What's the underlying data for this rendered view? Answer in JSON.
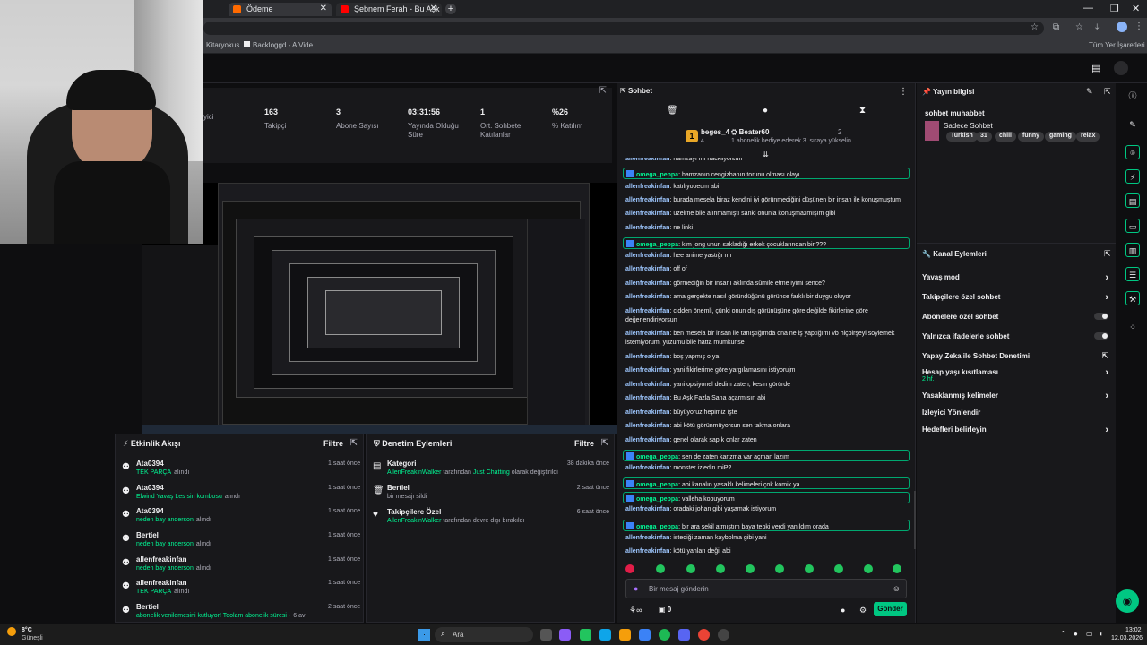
{
  "browser": {
    "tabs": [
      {
        "label": "Ödeme",
        "favicon": "#ff6a00"
      },
      {
        "label": "Şebnem Ferah - Bu Aşk Fazl",
        "favicon": "#ff0000"
      }
    ],
    "bookmarks": [
      "Kitaryokus...",
      "Backloggd - A Vide..."
    ],
    "all_bookmarks": "Tüm Yer İşaretleri"
  },
  "stats": [
    {
      "value": "",
      "label": "yici"
    },
    {
      "value": "163",
      "label": "Takipçi"
    },
    {
      "value": "3",
      "label": "Abone Sayısı"
    },
    {
      "value": "03:31:56",
      "label": "Yayında Olduğu Süre"
    },
    {
      "value": "1",
      "label": "Ort. Sohbete Katılanlar"
    },
    {
      "value": "%26",
      "label": "% Katılım"
    }
  ],
  "activity": {
    "title": "Etkinlik Akışı",
    "filter": "Filtre",
    "items": [
      {
        "name": "Ata0394",
        "sub": "TEK PARÇA",
        "sub2": "alındı",
        "time": "1 saat önce"
      },
      {
        "name": "Ata0394",
        "sub": "Elwind Yavaş Les sin kombosu",
        "sub2": "alındı",
        "time": "1 saat önce"
      },
      {
        "name": "Ata0394",
        "sub": "neden bay anderson",
        "sub2": "alındı",
        "time": "1 saat önce"
      },
      {
        "name": "Bertiel",
        "sub": "neden bay anderson",
        "sub2": "alındı",
        "time": "1 saat önce"
      },
      {
        "name": "allenfreakinfan",
        "sub": "neden bay anderson",
        "sub2": "alındı",
        "time": "1 saat önce"
      },
      {
        "name": "allenfreakinfan",
        "sub": "TEK PARÇA",
        "sub2": "alındı",
        "time": "1 saat önce"
      },
      {
        "name": "Bertiel",
        "sub": "abonelik venilemesini kutluyor! Toolam abonelik süresi -",
        "sub2": "6 av!",
        "time": "2 saat önce"
      }
    ]
  },
  "moderation": {
    "title": "Denetim Eylemleri",
    "filter": "Filtre",
    "items": [
      {
        "name": "Kategori",
        "actor": "AllenFreakinWalker",
        "mid": "tarafından",
        "hl": "Just Chatting",
        "rest": "olarak değiştirildi",
        "time": "38 dakika önce",
        "icon": "▤"
      },
      {
        "name": "Bertiel",
        "actor": "",
        "mid": "bir mesajı sildi",
        "hl": "",
        "rest": "",
        "time": "2 saat önce",
        "icon": "🗑"
      },
      {
        "name": "Takipçilere Özel",
        "actor": "AllenFreakinWalker",
        "mid": "tarafından devre dışı bırakıldı",
        "hl": "",
        "rest": "",
        "time": "6 saat önce",
        "icon": "♥"
      }
    ]
  },
  "chat": {
    "title": "Sohbet",
    "leader": {
      "user": "beges_4",
      "count": "4",
      "gifter": "Beater60",
      "gifter_count": "2",
      "note": "1 abonelik hediye ederek 3. sıraya yükselin"
    },
    "messages": [
      {
        "user": "allenfreakinfan",
        "text": "hamzayı mı hackliyorsun",
        "hl": false
      },
      {
        "user": "omega_peppa",
        "text": "hamzanın cengizhanın torunu olması olayı",
        "hl": true
      },
      {
        "user": "allenfreakinfan",
        "text": "katılıyooeum abi",
        "hl": false
      },
      {
        "user": "allenfreakinfan",
        "text": "burada mesela biraz kendini iyi görünmediğini düşünen bir insan ile konuşmuştum",
        "hl": false
      },
      {
        "user": "allenfreakinfan",
        "text": "üzelrne bile alınmamıştı sanki onunla konuşmazmışım gibi",
        "hl": false
      },
      {
        "user": "allenfreakinfan",
        "text": "ne linki",
        "hl": false
      },
      {
        "user": "omega_peppa",
        "text": "kim jong unun sakladığı erkek çocuklarından biri???",
        "hl": true
      },
      {
        "user": "allenfreakinfan",
        "text": "hee anime yastığı mı",
        "hl": false
      },
      {
        "user": "allenfreakinfan",
        "text": "off of",
        "hl": false
      },
      {
        "user": "allenfreakinfan",
        "text": "görmediğin bir insanı aklında sümile etme iyimi sence?",
        "hl": false
      },
      {
        "user": "allenfreakinfan",
        "text": "ama gerçekte nasıl göründüğünü görünce farklı bir duygu oluyor",
        "hl": false
      },
      {
        "user": "allenfreakinfan",
        "text": "cidden önemli, çünki onun dış görünüşüne göre değilde fikirlerine göre değerlendiriyorsun",
        "hl": false
      },
      {
        "user": "allenfreakinfan",
        "text": "ben mesela bir insan ile tanıştığımda ona ne iş yaptığımı vb hiçbirşeyi söylemek istemiyorum, yüzümü bile hatta mümkünse",
        "hl": false
      },
      {
        "user": "allenfreakinfan",
        "text": "boş yapmış o ya",
        "hl": false
      },
      {
        "user": "allenfreakinfan",
        "text": "yani fikirlerime göre yargılamasını istiyorujm",
        "hl": false
      },
      {
        "user": "allenfreakinfan",
        "text": "yani opsiyonel dedim zaten, kesin görürde",
        "hl": false
      },
      {
        "user": "allenfreakinfan",
        "text": "Bu Aşk Fazla Sana açarmısın abi",
        "hl": false
      },
      {
        "user": "allenfreakinfan",
        "text": "büyüyoruz hepimiz işte",
        "hl": false
      },
      {
        "user": "allenfreakinfan",
        "text": "abi kötü görünmüyorsun sen takma onlara",
        "hl": false
      },
      {
        "user": "allenfreakinfan",
        "text": "genel olarak sapık onlar zaten",
        "hl": false
      },
      {
        "user": "omega_peppa",
        "text": "sen de zaten karizma var açman lazım",
        "hl": true
      },
      {
        "user": "allenfreakinfan",
        "text": "monster izledin miP?",
        "hl": false
      },
      {
        "user": "omega_peppa",
        "text": "abi kanalın yasaklı kelimeleri çok komik ya",
        "hl": true
      },
      {
        "user": "omega_peppa",
        "text": "valleha kopuyorum",
        "hl": true
      },
      {
        "user": "allenfreakinfan",
        "text": "oradaki johan gibi yaşamak istiyorum",
        "hl": false
      },
      {
        "user": "omega_peppa",
        "text": "bir ara şekil atmıştım baya tepki verdi yanıldım orada",
        "hl": true
      },
      {
        "user": "allenfreakinfan",
        "text": "istediği zaman kaybolma gibi yani",
        "hl": false
      },
      {
        "user": "allenfreakinfan",
        "text": "kötü yanları değil abi",
        "hl": false
      }
    ],
    "input_placeholder": "Bir mesaj gönderin",
    "points": "0",
    "send": "Gönder"
  },
  "stream_info": {
    "title": "Yayın bilgisi",
    "stream_title": "sohbet muhabbet",
    "category": "Sadece Sohbet",
    "tags": [
      "Turkish",
      "31",
      "chill",
      "funny",
      "gaming",
      "relax"
    ]
  },
  "channel_actions": {
    "title": "Kanal Eylemleri",
    "items": [
      {
        "label": "Yavaş mod",
        "type": "chevron"
      },
      {
        "label": "Takipçilere özel sohbet",
        "type": "chevron"
      },
      {
        "label": "Abonelere özel sohbet",
        "type": "toggle"
      },
      {
        "label": "Yalnızca ifadelerle sohbet",
        "type": "toggle"
      },
      {
        "label": "Yapay Zeka ile Sohbet Denetimi",
        "type": "external"
      },
      {
        "label": "Hesap yaşı kısıtlaması",
        "sub": "2 hf.",
        "type": "chevron"
      },
      {
        "label": "Yasaklanmış kelimeler",
        "type": "chevron"
      },
      {
        "label": "İzleyici Yönlendir",
        "type": "none"
      },
      {
        "label": "Hedefleri belirleyin",
        "type": "chevron"
      }
    ]
  },
  "taskbar": {
    "weather_temp": "8°C",
    "weather_desc": "Güneşli",
    "search": "Ara",
    "time": "13:02",
    "date": "12.03.2026"
  }
}
